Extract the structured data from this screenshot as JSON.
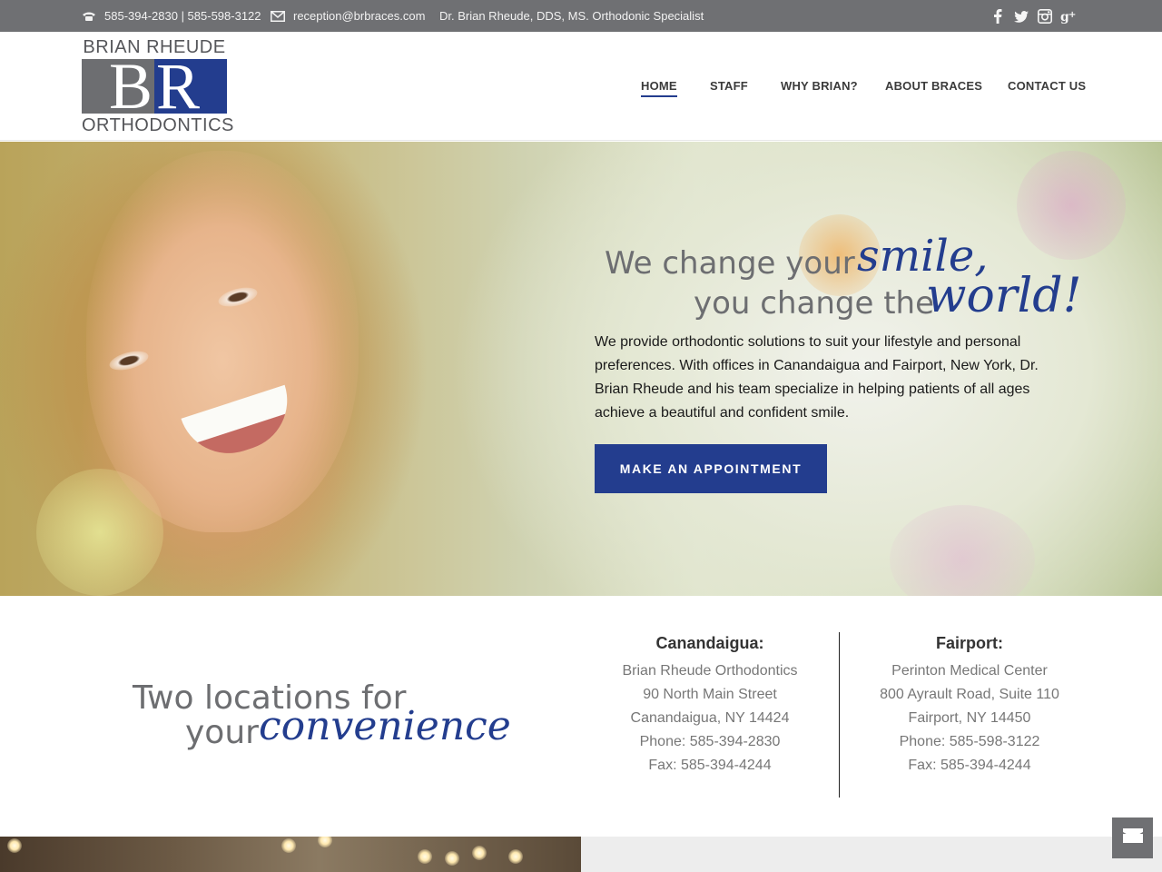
{
  "topbar": {
    "phones": "585-394-2830 | 585-598-3122",
    "email": "reception@brbraces.com",
    "tagline": "Dr. Brian Rheude, DDS, MS. Orthodonic Specialist",
    "phone_icon": "phone-icon",
    "email_icon": "envelope-icon",
    "social": [
      {
        "name": "facebook-icon",
        "glyph": "f"
      },
      {
        "name": "twitter-icon",
        "glyph": "t"
      },
      {
        "name": "instagram-icon",
        "glyph": "◘"
      },
      {
        "name": "google-plus-icon",
        "glyph": "g+"
      }
    ]
  },
  "logo": {
    "top": "BRIAN RHEUDE",
    "letter_b": "B",
    "letter_r": "R",
    "bottom": "ORTHODONTICS"
  },
  "nav": {
    "items": [
      {
        "label": "HOME",
        "active": true
      },
      {
        "label": "STAFF",
        "active": false
      },
      {
        "label": "WHY BRIAN?",
        "active": false
      },
      {
        "label": "ABOUT BRACES",
        "active": false
      },
      {
        "label": "CONTACT US",
        "active": false
      }
    ]
  },
  "hero": {
    "line1": "We change your",
    "script1": "smile,",
    "line2": "you change the",
    "script2": "world!",
    "intro": "We provide orthodontic solutions to suit your lifestyle and personal preferences. With offices in Canandaigua and Fairport, New York, Dr. Brian Rheude and his team specialize in helping patients of all ages achieve a beautiful and confident smile.",
    "cta": "MAKE AN APPOINTMENT"
  },
  "locations": {
    "heading1": "Two locations for",
    "heading2": "your",
    "script": "convenience",
    "offices": [
      {
        "name": "Canandaigua:",
        "lines": [
          "Brian Rheude Orthodontics",
          "90 North Main Street",
          "Canandaigua, NY 14424",
          "Phone: 585-394-2830",
          "Fax: 585-394-4244"
        ]
      },
      {
        "name": "Fairport:",
        "lines": [
          "Perinton Medical Center",
          "800 Ayrault Road, Suite 110",
          "Fairport, NY 14450",
          "Phone: 585-598-3122",
          "Fax: 585-394-4244"
        ]
      }
    ]
  },
  "colors": {
    "brand_blue": "#233d8e",
    "topbar_gray": "#6f7073",
    "logo_gray": "#6d6e71"
  },
  "floating_contact_icon": "envelope-icon"
}
